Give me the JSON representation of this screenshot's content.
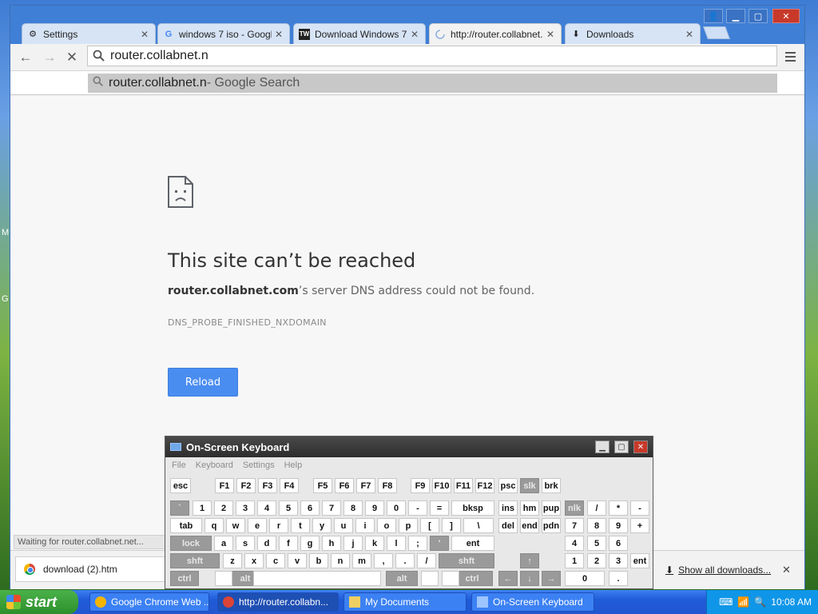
{
  "desktop": {
    "glyph_m": "M",
    "glyph_g": "G"
  },
  "browser": {
    "tabs": [
      {
        "label": "Settings",
        "icon": "gear-icon"
      },
      {
        "label": "windows 7 iso - Google S",
        "icon": "google-icon"
      },
      {
        "label": "Download Windows 7 IS",
        "icon": "tw-icon"
      },
      {
        "label": "http://router.collabnet.",
        "icon": "loading-icon"
      },
      {
        "label": "Downloads",
        "icon": "download-icon"
      }
    ],
    "address": "router.collabnet.n",
    "suggestion": {
      "query": "router.collabnet.n",
      "hint": " - Google Search"
    },
    "error": {
      "title": "This site can’t be reached",
      "host": "router.collabnet.com",
      "desc_rest": "’s server DNS address could not be found.",
      "code": "DNS_PROBE_FINISHED_NXDOMAIN",
      "reload_label": "Reload"
    },
    "status": "Waiting for router.collabnet.net...",
    "download": {
      "file": "download (2).htm",
      "show_all": "Show all downloads..."
    }
  },
  "osk": {
    "title": "On-Screen Keyboard",
    "menu": [
      "File",
      "Keyboard",
      "Settings",
      "Help"
    ],
    "rows": [
      [
        "esc",
        "F1",
        "F2",
        "F3",
        "F4",
        "F5",
        "F6",
        "F7",
        "F8",
        "F9",
        "F10",
        "F11",
        "F12",
        "psc",
        "slk",
        "brk"
      ],
      [
        "`",
        "1",
        "2",
        "3",
        "4",
        "5",
        "6",
        "7",
        "8",
        "9",
        "0",
        "-",
        "=",
        "bksp",
        "ins",
        "hm",
        "pup",
        "nlk",
        "/",
        "*",
        "-"
      ],
      [
        "tab",
        "q",
        "w",
        "e",
        "r",
        "t",
        "y",
        "u",
        "i",
        "o",
        "p",
        "[",
        "]",
        "\\",
        "del",
        "end",
        "pdn",
        "7",
        "8",
        "9",
        "+"
      ],
      [
        "lock",
        "a",
        "s",
        "d",
        "f",
        "g",
        "h",
        "j",
        "k",
        "l",
        ";",
        "'",
        "ent",
        "4",
        "5",
        "6"
      ],
      [
        "shft",
        "z",
        "x",
        "c",
        "v",
        "b",
        "n",
        "m",
        ",",
        ".",
        "/",
        "shft",
        "1",
        "2",
        "3",
        "ent"
      ],
      [
        "ctrl",
        "alt",
        "alt",
        "ctrl",
        "0",
        "."
      ]
    ]
  },
  "taskbar": {
    "start": "start",
    "items": [
      "Google Chrome Web ...",
      "http://router.collabn...",
      "My Documents",
      "On-Screen Keyboard"
    ],
    "clock": "10:08 AM"
  }
}
